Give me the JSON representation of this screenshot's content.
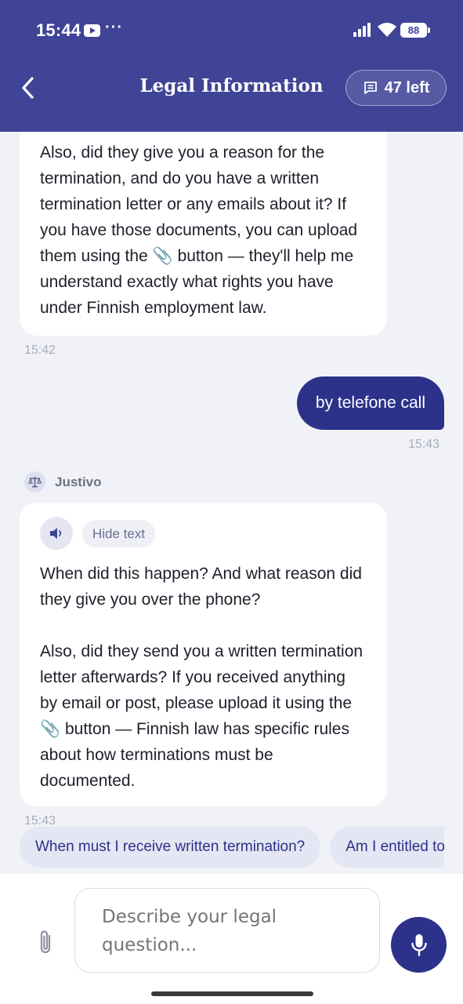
{
  "status_bar": {
    "time": "15:44",
    "dots": "···",
    "battery": "88"
  },
  "header": {
    "title": "Legal Information",
    "credits": "47 left"
  },
  "messages": {
    "ai_1": {
      "text": "Also, did they give you a reason for the termination, and do you have a written termination letter or any emails about it? If you have those documents, you can upload them using the 📎 button — they'll help me understand exactly what rights you have under Finnish employment law.",
      "time": "15:42"
    },
    "user_1": {
      "text": "by telefone call",
      "time": "15:43"
    },
    "ai_2": {
      "sender": "Justivo",
      "hide_label": "Hide text",
      "text": "When did this happen? And what reason did they give you over the phone?\n\nAlso, did they send you a written termination letter afterwards? If you received anything by email or post, please upload it using the 📎 button — Finnish law has specific rules about how terminations must be documented.",
      "time": "15:43"
    }
  },
  "suggestions": [
    "When must I receive written termination?",
    "Am I entitled to severance?"
  ],
  "composer": {
    "placeholder": "Describe your legal question..."
  },
  "icons": {
    "back": "chevron-left-icon",
    "credits": "message-icon",
    "avatar": "scales-icon",
    "speaker": "speaker-icon",
    "attach": "paperclip-icon",
    "mic": "microphone-icon"
  },
  "colors": {
    "brand": "#3F4496",
    "user_bubble": "#2C318A",
    "background": "#F1F2F7"
  }
}
